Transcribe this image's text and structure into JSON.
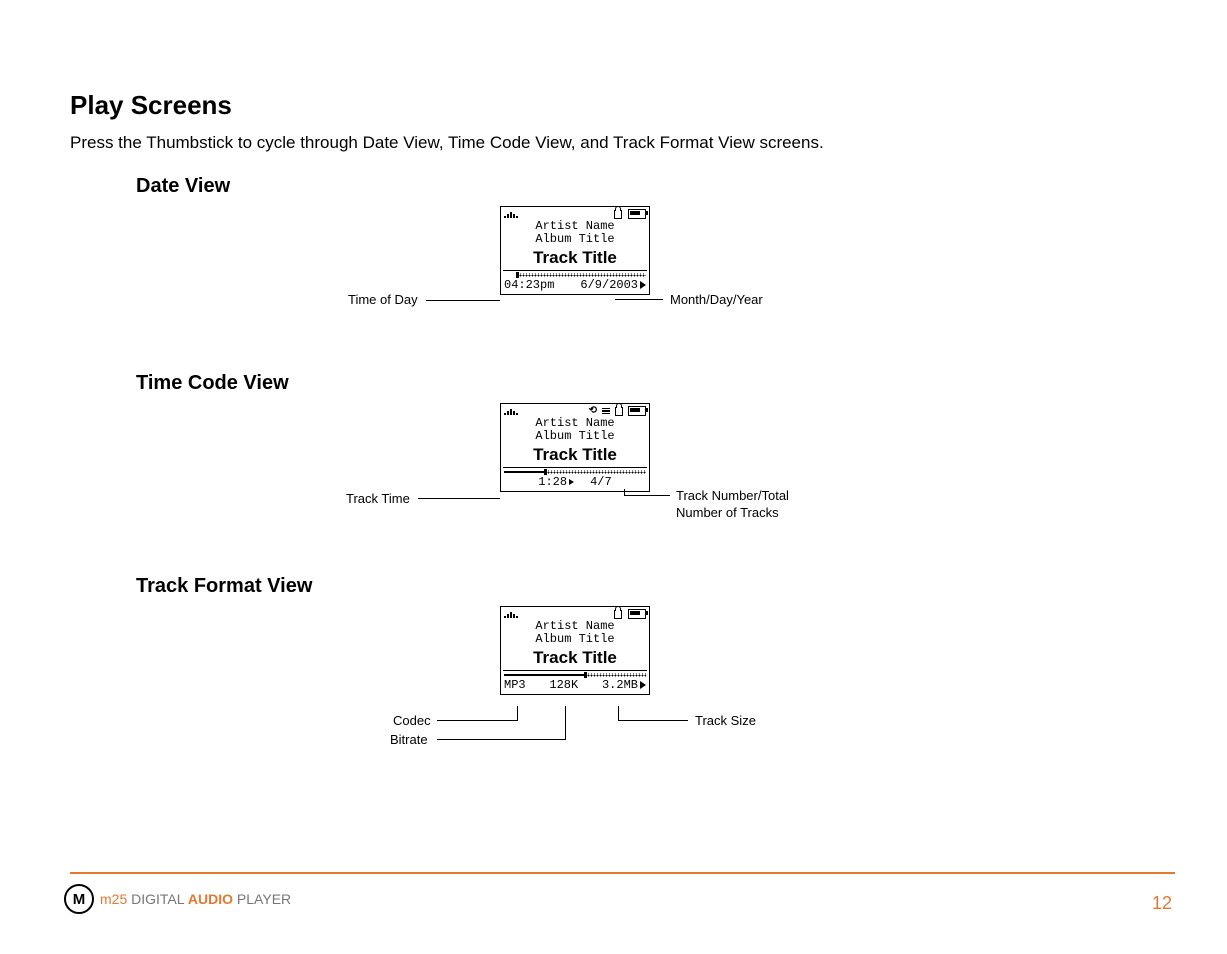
{
  "heading": "Play Screens",
  "intro": "Press the Thumbstick to cycle through Date View, Time Code View, and Track Format View screens.",
  "dateView": {
    "title": "Date View",
    "artist": "Artist Name",
    "album": "Album Title",
    "track": "Track Title",
    "time": "04:23pm",
    "date": "6/9/2003",
    "leftLabel": "Time of Day",
    "rightLabel": "Month/Day/Year"
  },
  "timeCodeView": {
    "title": "Time Code View",
    "artist": "Artist Name",
    "album": "Album Title",
    "track": "Track Title",
    "elapsed": "1:28",
    "count": "4/7",
    "leftLabel": "Track Time",
    "rightLabel1": "Track Number/Total",
    "rightLabel2": "Number of Tracks"
  },
  "trackFormatView": {
    "title": "Track Format View",
    "artist": "Artist Name",
    "album": "Album Title",
    "track": "Track Title",
    "codec": "MP3",
    "bitrate": "128K",
    "size": "3.2MB",
    "leftLabel1": "Codec",
    "leftLabel2": "Bitrate",
    "rightLabel": "Track Size"
  },
  "footer": {
    "model": "m25",
    "text1": " DIGITAL ",
    "textBold": "AUDIO",
    "text2": " PLAYER",
    "page": "12"
  }
}
